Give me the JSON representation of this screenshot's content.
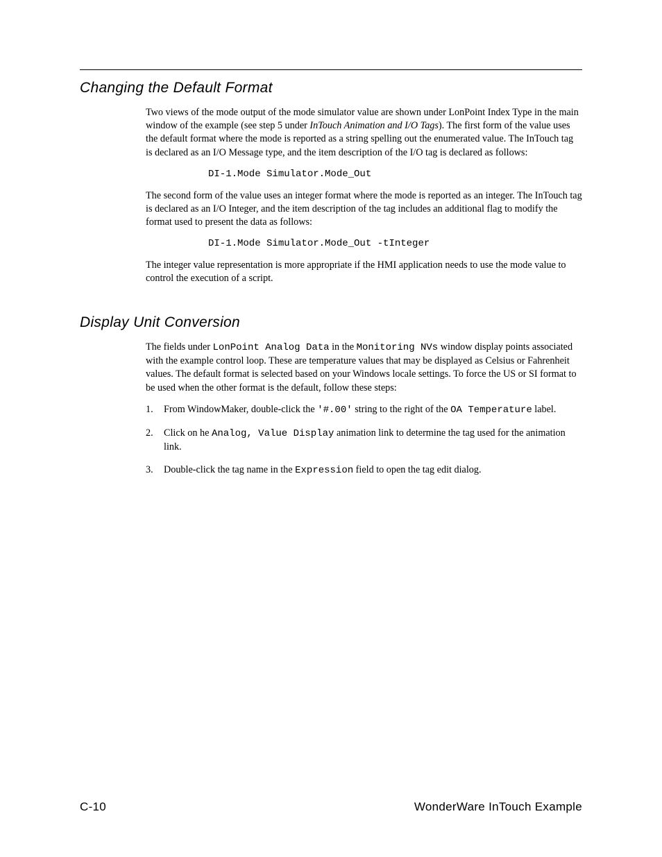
{
  "section1": {
    "heading": "Changing the Default Format",
    "para1_a": "Two views of the mode output of the mode simulator value are shown under LonPoint Index Type in the main window of the example (see step 5 under ",
    "para1_italic": "InTouch Animation and I/O Tags",
    "para1_b": "). The first form of the value uses the default format where the mode is reported as a string spelling out the enumerated value. The InTouch tag is declared as an I/O Message type, and the item description of the I/O tag is declared as follows:",
    "code1": "DI-1.Mode Simulator.Mode_Out",
    "para2": "The second form of the value uses an integer format where the mode is reported as an integer. The InTouch tag is declared as an I/O Integer, and the item description of the tag includes an additional flag to modify the format used to present the data as follows:",
    "code2": "DI-1.Mode Simulator.Mode_Out -tInteger",
    "para3": "The integer value representation is more appropriate if the HMI application needs to use the mode value to control the execution of a script."
  },
  "section2": {
    "heading": "Display Unit Conversion",
    "para1_a": "The fields under ",
    "para1_m1": "LonPoint Analog Data",
    "para1_b": " in the ",
    "para1_m2": "Monitoring NVs",
    "para1_c": " window display points associated with the example control loop. These are temperature values that may be displayed as Celsius or Fahrenheit values. The default format is selected based on your Windows locale settings. To force the US or SI format to be used when the other format is the default, follow these steps:",
    "steps": [
      {
        "num": "1.",
        "a": "From WindowMaker, double-click the ",
        "m1": "'#.00'",
        "b": " string to the right of the ",
        "m2": "OA Temperature",
        "c": " label."
      },
      {
        "num": "2.",
        "a": "Click on he ",
        "m1": "Analog, Value Display",
        "b": " animation link to determine the tag used for the animation link.",
        "m2": "",
        "c": ""
      },
      {
        "num": "3.",
        "a": "Double-click the tag name in the ",
        "m1": "Expression",
        "b": " field to open the tag edit dialog.",
        "m2": "",
        "c": ""
      }
    ]
  },
  "footer": {
    "left": "C-10",
    "right": "WonderWare InTouch Example"
  }
}
